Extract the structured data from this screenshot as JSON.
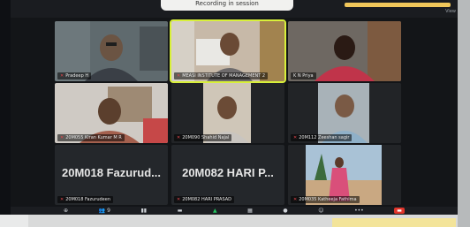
{
  "app": {
    "top_notice": "Recording in session",
    "view_label": "View",
    "accent_color": "#d8f03a",
    "mute_color": "#e5484d"
  },
  "participants": [
    {
      "name": "Pradeep H",
      "muted": true,
      "has_video": true,
      "avatar_text": ""
    },
    {
      "name": "MEASI INSTITUTE OF MANAGEMENT 2",
      "muted": true,
      "has_video": true,
      "active_speaker": true
    },
    {
      "name": "K N Priya",
      "muted": false,
      "has_video": true
    },
    {
      "name": "20M055 Kiran Kumar M R",
      "muted": true,
      "has_video": true
    },
    {
      "name": "20M090 Shahid Najal",
      "muted": true,
      "has_video": true
    },
    {
      "name": "20M112 Zeeshan sagir",
      "muted": true,
      "has_video": true
    },
    {
      "name": "20M018 Fazurudeen",
      "muted": true,
      "has_video": false,
      "display_name": "20M018 Fazurud..."
    },
    {
      "name": "20M082 HARI PRASAD",
      "muted": true,
      "has_video": false,
      "display_name": "20M082 HARI P..."
    },
    {
      "name": "20M035 Katheeja Fathima",
      "muted": true,
      "has_video": true
    }
  ],
  "toolbar": {
    "participants_count": "9",
    "items": [
      {
        "icon": "participants-icon",
        "label": "9"
      },
      {
        "icon": "chart-icon",
        "label": ""
      },
      {
        "icon": "chat-icon",
        "label": ""
      },
      {
        "icon": "share-screen-icon",
        "label": ""
      },
      {
        "icon": "grid-icon",
        "label": ""
      },
      {
        "icon": "record-icon",
        "label": ""
      },
      {
        "icon": "reactions-icon",
        "label": ""
      },
      {
        "icon": "more-icon",
        "label": ""
      },
      {
        "icon": "leave-icon",
        "label": ""
      }
    ]
  }
}
